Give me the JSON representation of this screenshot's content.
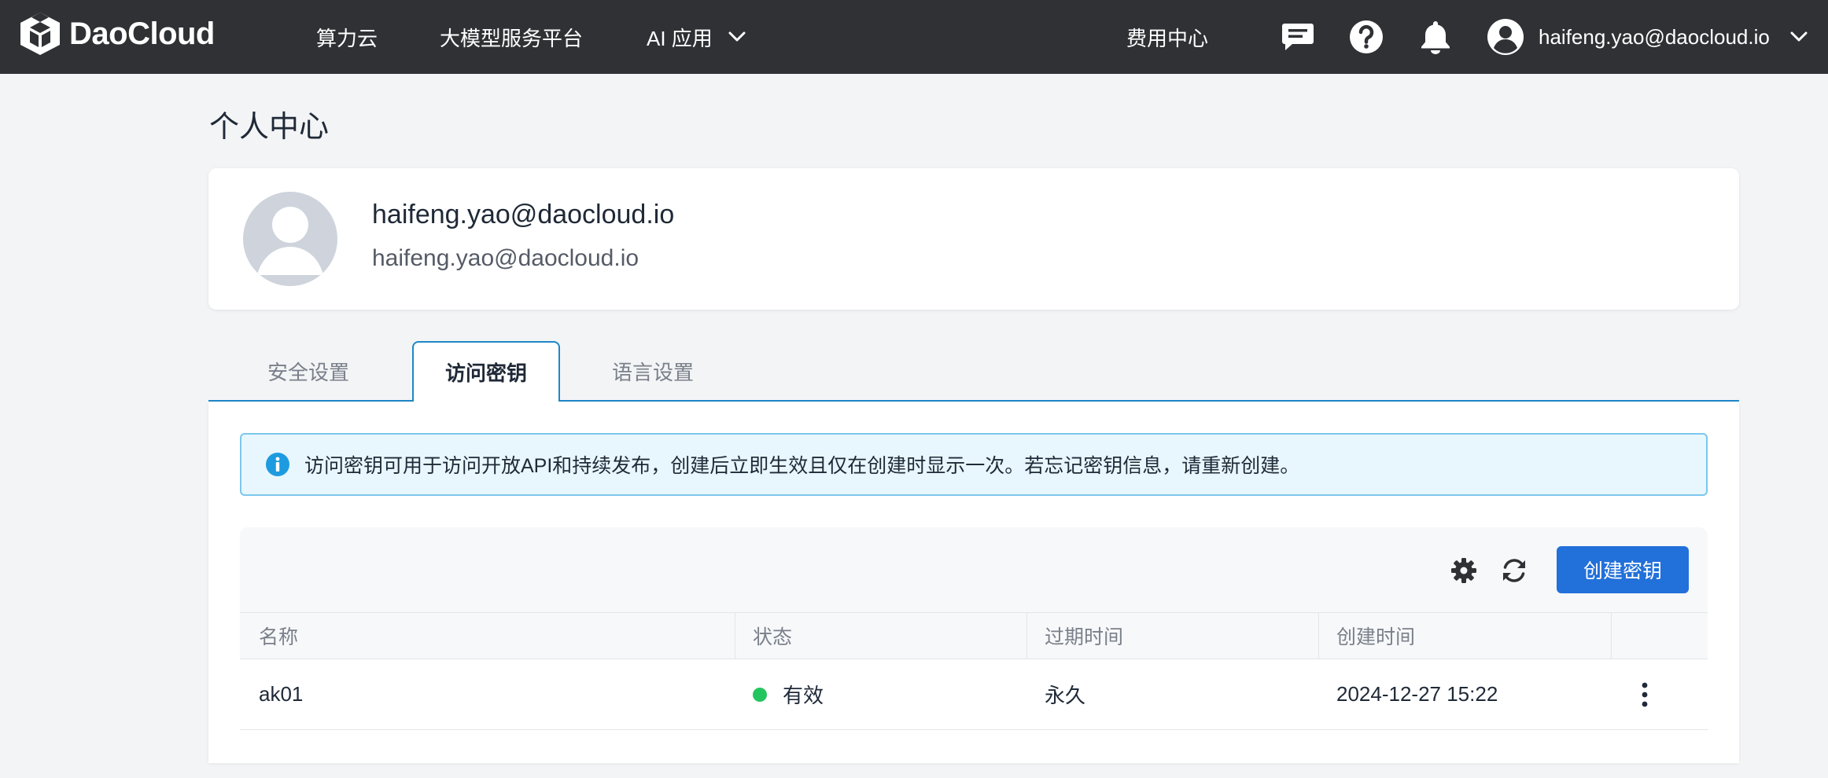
{
  "header": {
    "brand": "DaoCloud",
    "nav": [
      {
        "label": "算力云"
      },
      {
        "label": "大模型服务平台"
      },
      {
        "label": "AI 应用"
      }
    ],
    "billing_label": "费用中心",
    "user_email": "haifeng.yao@daocloud.io",
    "icons": [
      "message-icon",
      "help-icon",
      "bell-icon",
      "user-avatar-icon",
      "chevron-down-icon"
    ]
  },
  "page": {
    "title": "个人中心"
  },
  "profile": {
    "name": "haifeng.yao@daocloud.io",
    "email": "haifeng.yao@daocloud.io"
  },
  "tabs": [
    {
      "label": "安全设置",
      "active": false
    },
    {
      "label": "访问密钥",
      "active": true
    },
    {
      "label": "语言设置",
      "active": false
    }
  ],
  "info": {
    "text": "访问密钥可用于访问开放API和持续发布，创建后立即生效且仅在创建时显示一次。若忘记密钥信息，请重新创建。"
  },
  "toolbar": {
    "create_label": "创建密钥"
  },
  "table": {
    "columns": [
      "名称",
      "状态",
      "过期时间",
      "创建时间"
    ],
    "rows": [
      {
        "name": "ak01",
        "status": "有效",
        "expires": "永久",
        "created": "2024-12-27 15:22"
      }
    ]
  },
  "colors": {
    "topbar": "#2f3135",
    "accent": "#2270d9",
    "tab_border": "#1e88c7",
    "status_ok": "#22c55e",
    "info_bg": "#e8f6fd"
  }
}
